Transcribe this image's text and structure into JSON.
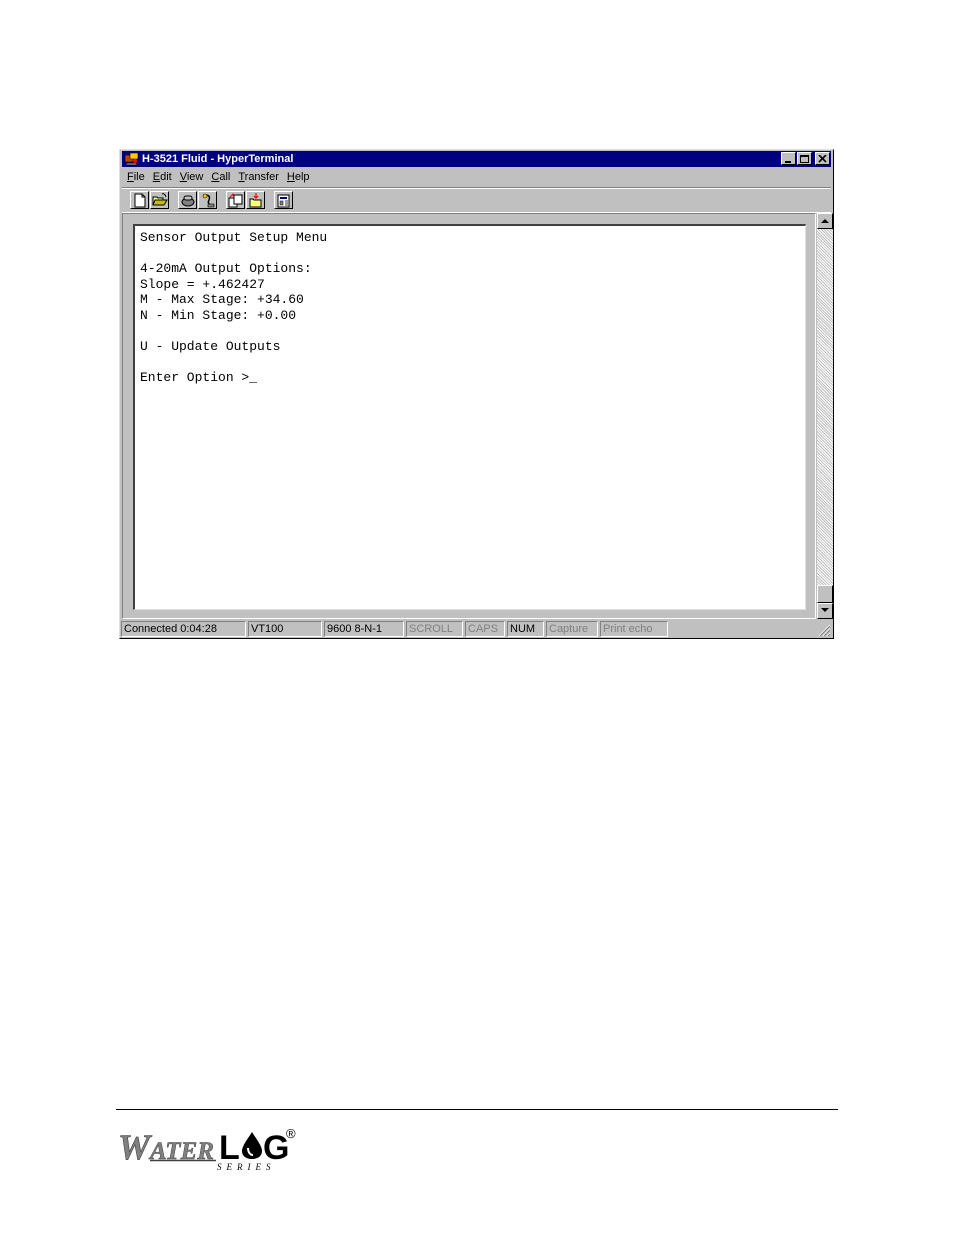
{
  "window": {
    "title": "H-3521 Fluid - HyperTerminal"
  },
  "menu": [
    {
      "label": "File",
      "accel": "F",
      "rest": "ile"
    },
    {
      "label": "Edit",
      "accel": "E",
      "rest": "dit"
    },
    {
      "label": "View",
      "accel": "V",
      "rest": "iew"
    },
    {
      "label": "Call",
      "accel": "C",
      "rest": "all"
    },
    {
      "label": "Transfer",
      "accel": "T",
      "rest": "ransfer"
    },
    {
      "label": "Help",
      "accel": "H",
      "rest": "elp"
    }
  ],
  "toolbar": {
    "icons": [
      "new-icon",
      "open-icon",
      "connect-icon",
      "disconnect-icon",
      "send-icon",
      "receive-icon",
      "properties-icon"
    ]
  },
  "terminal": {
    "lines": [
      "Sensor Output Setup Menu",
      "",
      "4-20mA Output Options:",
      "Slope = +.462427",
      "M - Max Stage: +34.60",
      "N - Min Stage: +0.00",
      "",
      "U - Update Outputs",
      "",
      "Enter Option >_"
    ]
  },
  "status": {
    "connected": "Connected 0:04:28",
    "emulation": "VT100",
    "port_settings": "9600 8-N-1",
    "scroll": "SCROLL",
    "caps": "CAPS",
    "num": "NUM",
    "capture": "Capture",
    "print_echo": "Print echo"
  },
  "footer": {
    "logo_text": "WATERLOG SERIES",
    "registered": "®"
  },
  "colors": {
    "titlebar": "#000080",
    "face": "#c0c0c0",
    "dim_text": "#808080"
  }
}
